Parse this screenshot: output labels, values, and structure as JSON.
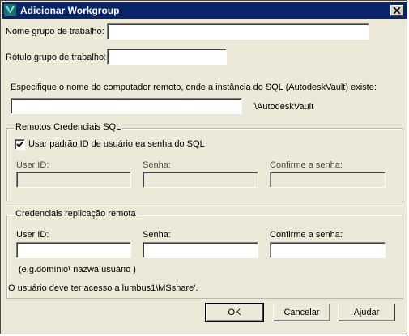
{
  "window": {
    "title": "Adicionar Workgroup"
  },
  "fields": {
    "workgroup_name_label": "Nome grupo de trabalho:",
    "workgroup_name_value": "",
    "workgroup_label_label": "Rótulo grupo de trabalho:",
    "workgroup_label_value": "",
    "remote_computer_prompt": "Especifique o nome do computador remoto, onde a instância do SQL (AutodeskVault) existe:",
    "remote_computer_value": "",
    "instance_suffix": "\\AutodeskVault"
  },
  "sql_credentials": {
    "legend": "Remotos Credenciais SQL",
    "use_default_label": "Usar padrão ID de usuário ea senha do SQL",
    "use_default_checked": true,
    "user_id_label": "User ID:",
    "password_label": "Senha:",
    "confirm_label": "Confirme a senha:"
  },
  "replication_credentials": {
    "legend": "Credenciais replicação remota",
    "user_id_label": "User ID:",
    "password_label": "Senha:",
    "confirm_label": "Confirme a senha:",
    "example_hint": "(e.g.domínio\\ nazwa usuário )"
  },
  "access_note": "O usuário deve ter acesso a lumbus1\\MSshare'.",
  "buttons": {
    "ok": "OK",
    "cancel": "Cancelar",
    "help": "Ajudar"
  },
  "colors": {
    "titlebar": "#0a246a",
    "face": "#ece9d8",
    "icon_accent": "#2aa198"
  }
}
